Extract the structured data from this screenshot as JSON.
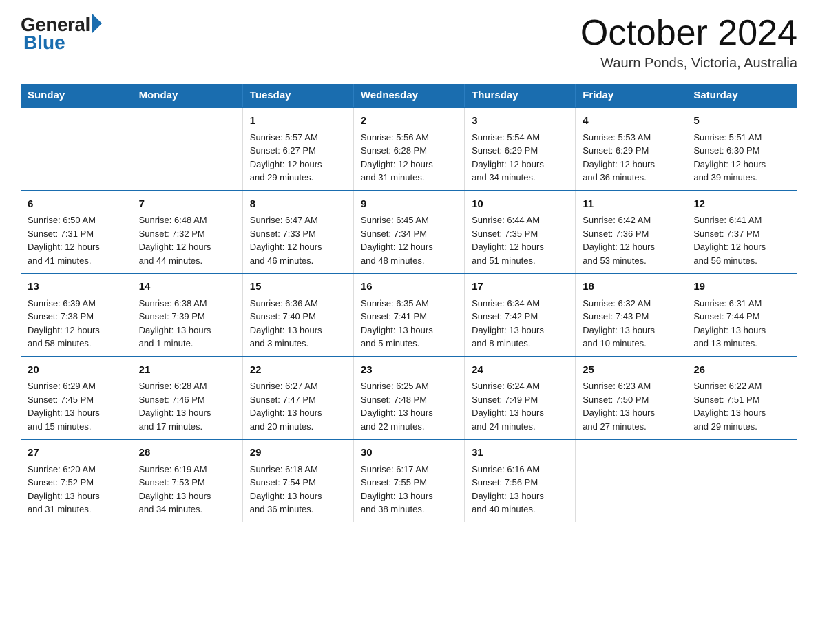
{
  "header": {
    "logo_general": "General",
    "logo_blue": "Blue",
    "month_title": "October 2024",
    "location": "Waurn Ponds, Victoria, Australia"
  },
  "days_of_week": [
    "Sunday",
    "Monday",
    "Tuesday",
    "Wednesday",
    "Thursday",
    "Friday",
    "Saturday"
  ],
  "weeks": [
    [
      {
        "day": "",
        "info": ""
      },
      {
        "day": "",
        "info": ""
      },
      {
        "day": "1",
        "info": "Sunrise: 5:57 AM\nSunset: 6:27 PM\nDaylight: 12 hours\nand 29 minutes."
      },
      {
        "day": "2",
        "info": "Sunrise: 5:56 AM\nSunset: 6:28 PM\nDaylight: 12 hours\nand 31 minutes."
      },
      {
        "day": "3",
        "info": "Sunrise: 5:54 AM\nSunset: 6:29 PM\nDaylight: 12 hours\nand 34 minutes."
      },
      {
        "day": "4",
        "info": "Sunrise: 5:53 AM\nSunset: 6:29 PM\nDaylight: 12 hours\nand 36 minutes."
      },
      {
        "day": "5",
        "info": "Sunrise: 5:51 AM\nSunset: 6:30 PM\nDaylight: 12 hours\nand 39 minutes."
      }
    ],
    [
      {
        "day": "6",
        "info": "Sunrise: 6:50 AM\nSunset: 7:31 PM\nDaylight: 12 hours\nand 41 minutes."
      },
      {
        "day": "7",
        "info": "Sunrise: 6:48 AM\nSunset: 7:32 PM\nDaylight: 12 hours\nand 44 minutes."
      },
      {
        "day": "8",
        "info": "Sunrise: 6:47 AM\nSunset: 7:33 PM\nDaylight: 12 hours\nand 46 minutes."
      },
      {
        "day": "9",
        "info": "Sunrise: 6:45 AM\nSunset: 7:34 PM\nDaylight: 12 hours\nand 48 minutes."
      },
      {
        "day": "10",
        "info": "Sunrise: 6:44 AM\nSunset: 7:35 PM\nDaylight: 12 hours\nand 51 minutes."
      },
      {
        "day": "11",
        "info": "Sunrise: 6:42 AM\nSunset: 7:36 PM\nDaylight: 12 hours\nand 53 minutes."
      },
      {
        "day": "12",
        "info": "Sunrise: 6:41 AM\nSunset: 7:37 PM\nDaylight: 12 hours\nand 56 minutes."
      }
    ],
    [
      {
        "day": "13",
        "info": "Sunrise: 6:39 AM\nSunset: 7:38 PM\nDaylight: 12 hours\nand 58 minutes."
      },
      {
        "day": "14",
        "info": "Sunrise: 6:38 AM\nSunset: 7:39 PM\nDaylight: 13 hours\nand 1 minute."
      },
      {
        "day": "15",
        "info": "Sunrise: 6:36 AM\nSunset: 7:40 PM\nDaylight: 13 hours\nand 3 minutes."
      },
      {
        "day": "16",
        "info": "Sunrise: 6:35 AM\nSunset: 7:41 PM\nDaylight: 13 hours\nand 5 minutes."
      },
      {
        "day": "17",
        "info": "Sunrise: 6:34 AM\nSunset: 7:42 PM\nDaylight: 13 hours\nand 8 minutes."
      },
      {
        "day": "18",
        "info": "Sunrise: 6:32 AM\nSunset: 7:43 PM\nDaylight: 13 hours\nand 10 minutes."
      },
      {
        "day": "19",
        "info": "Sunrise: 6:31 AM\nSunset: 7:44 PM\nDaylight: 13 hours\nand 13 minutes."
      }
    ],
    [
      {
        "day": "20",
        "info": "Sunrise: 6:29 AM\nSunset: 7:45 PM\nDaylight: 13 hours\nand 15 minutes."
      },
      {
        "day": "21",
        "info": "Sunrise: 6:28 AM\nSunset: 7:46 PM\nDaylight: 13 hours\nand 17 minutes."
      },
      {
        "day": "22",
        "info": "Sunrise: 6:27 AM\nSunset: 7:47 PM\nDaylight: 13 hours\nand 20 minutes."
      },
      {
        "day": "23",
        "info": "Sunrise: 6:25 AM\nSunset: 7:48 PM\nDaylight: 13 hours\nand 22 minutes."
      },
      {
        "day": "24",
        "info": "Sunrise: 6:24 AM\nSunset: 7:49 PM\nDaylight: 13 hours\nand 24 minutes."
      },
      {
        "day": "25",
        "info": "Sunrise: 6:23 AM\nSunset: 7:50 PM\nDaylight: 13 hours\nand 27 minutes."
      },
      {
        "day": "26",
        "info": "Sunrise: 6:22 AM\nSunset: 7:51 PM\nDaylight: 13 hours\nand 29 minutes."
      }
    ],
    [
      {
        "day": "27",
        "info": "Sunrise: 6:20 AM\nSunset: 7:52 PM\nDaylight: 13 hours\nand 31 minutes."
      },
      {
        "day": "28",
        "info": "Sunrise: 6:19 AM\nSunset: 7:53 PM\nDaylight: 13 hours\nand 34 minutes."
      },
      {
        "day": "29",
        "info": "Sunrise: 6:18 AM\nSunset: 7:54 PM\nDaylight: 13 hours\nand 36 minutes."
      },
      {
        "day": "30",
        "info": "Sunrise: 6:17 AM\nSunset: 7:55 PM\nDaylight: 13 hours\nand 38 minutes."
      },
      {
        "day": "31",
        "info": "Sunrise: 6:16 AM\nSunset: 7:56 PM\nDaylight: 13 hours\nand 40 minutes."
      },
      {
        "day": "",
        "info": ""
      },
      {
        "day": "",
        "info": ""
      }
    ]
  ]
}
